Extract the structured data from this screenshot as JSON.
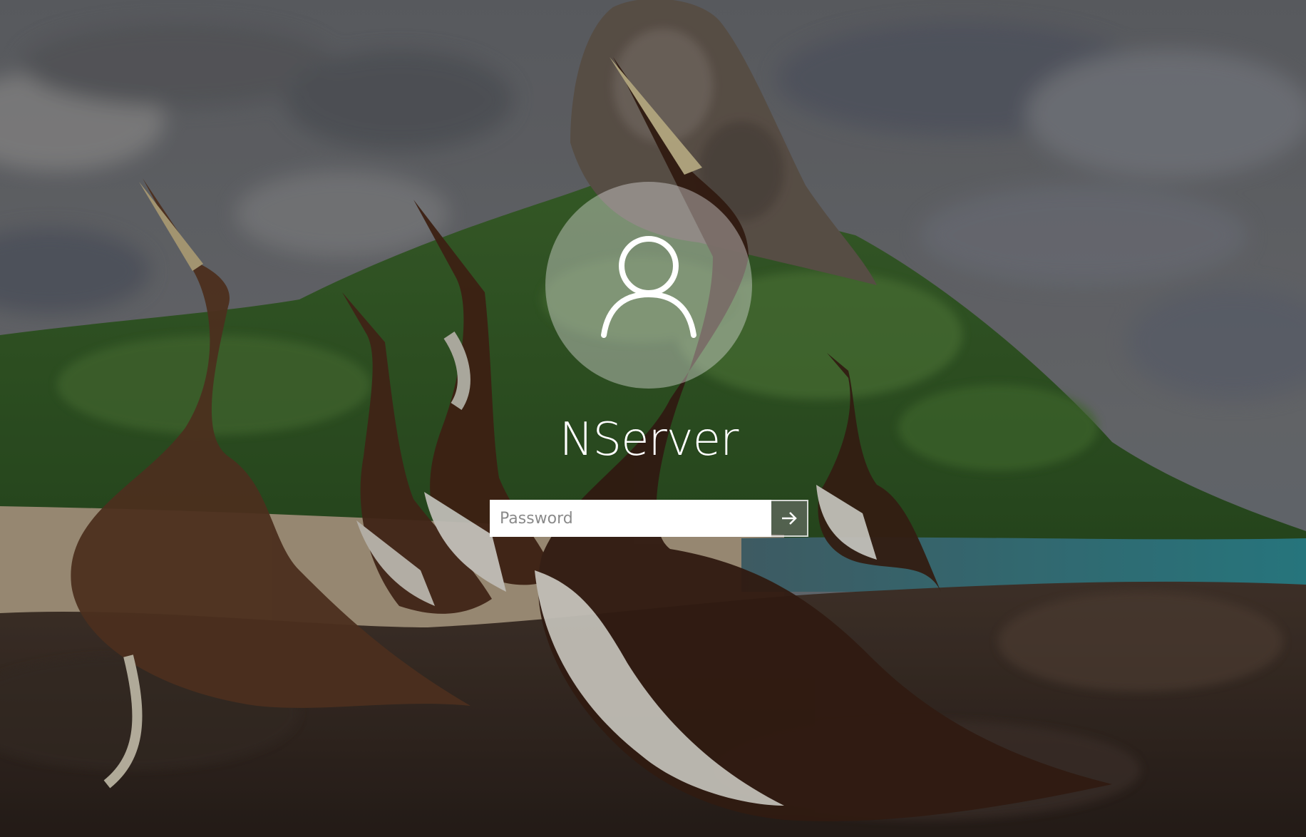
{
  "lock_screen": {
    "background": "birds-on-rocky-beach-wallpaper",
    "avatar_icon": "user-silhouette-icon",
    "username": "NServer",
    "password_placeholder": "Password",
    "submit_icon": "arrow-right-icon"
  },
  "colors": {
    "text": "#ffffff",
    "input_background": "#ffffff",
    "placeholder": "#8a8a8a",
    "submit_background": "#7a7a7a"
  }
}
